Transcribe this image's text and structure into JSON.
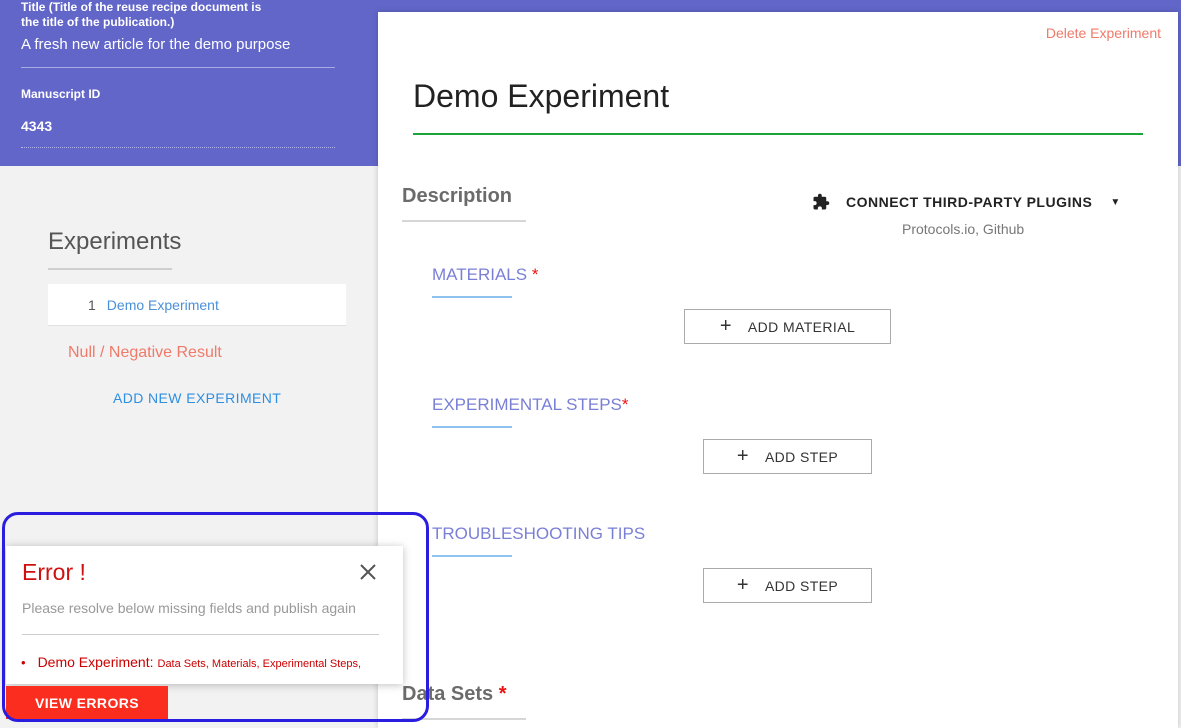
{
  "header": {
    "title_label": "Title (Title of the reuse recipe document is the title of the publication.)",
    "title_value": "A fresh new article for the demo purpose",
    "manuscript_id_label": "Manuscript ID",
    "manuscript_id_value": "4343"
  },
  "sidebar": {
    "heading": "Experiments",
    "items": [
      {
        "number": "1",
        "label": "Demo Experiment"
      }
    ],
    "null_result": "Null / Negative Result",
    "add_new": "ADD NEW EXPERIMENT"
  },
  "main": {
    "delete_label": "Delete Experiment",
    "title": "Demo Experiment",
    "description_heading": "Description",
    "plugins_label": "CONNECT THIRD-PARTY PLUGINS",
    "plugins_sub": "Protocols.io, Github",
    "sections": [
      {
        "label": "MATERIALS",
        "required_mark": "*",
        "button_label": "ADD MATERIAL"
      },
      {
        "label": "EXPERIMENTAL STEPS",
        "required_mark": "*",
        "button_label": "ADD STEP"
      },
      {
        "label": "TROUBLESHOOTING TIPS",
        "required_mark": "",
        "button_label": "ADD STEP"
      }
    ],
    "datasets_heading": "Data Sets",
    "datasets_required_mark": "*"
  },
  "error_panel": {
    "title": "Error !",
    "message": "Please resolve below missing fields and publish again",
    "items": [
      {
        "title": "Demo Experiment:",
        "fields": "Data Sets, Materials, Experimental Steps,"
      }
    ],
    "view_errors_label": "VIEW ERRORS"
  },
  "colors": {
    "header_bg": "#6266c9",
    "accent_green": "#1aa53a",
    "error_red": "#d01010",
    "highlight_blue": "#2a1de0"
  }
}
